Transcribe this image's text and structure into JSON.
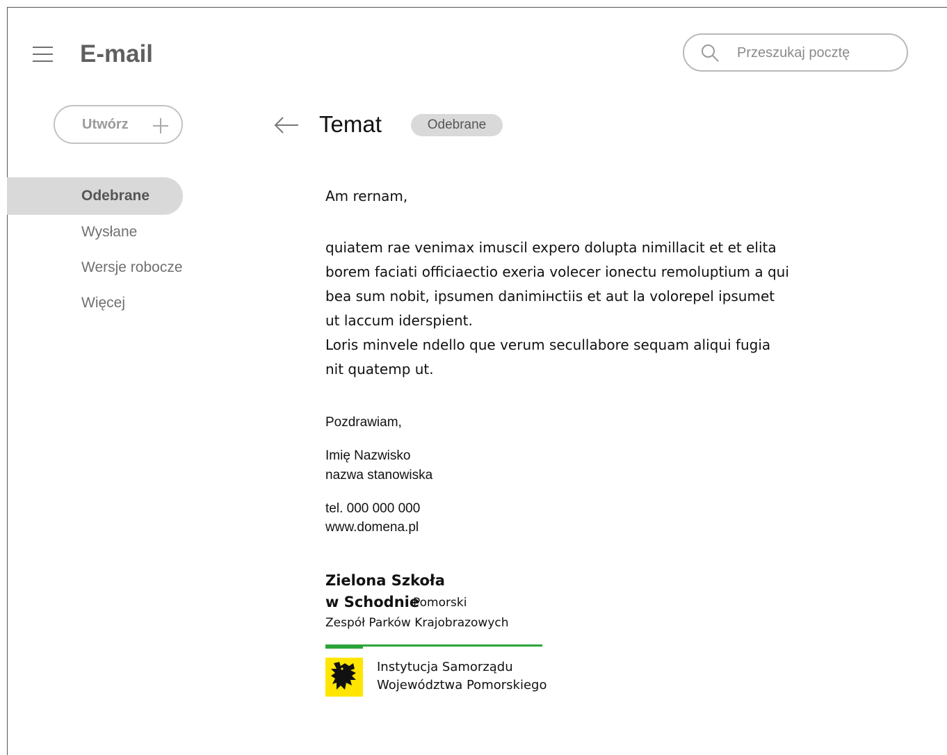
{
  "header": {
    "app_title": "E-mail",
    "search_placeholder": "Przeszukaj pocztę"
  },
  "sidebar": {
    "compose_label": "Utwórz",
    "items": [
      {
        "label": "Odebrane",
        "active": true
      },
      {
        "label": "Wysłane",
        "active": false
      },
      {
        "label": "Wersje robocze",
        "active": false
      },
      {
        "label": "Więcej",
        "active": false
      }
    ]
  },
  "message": {
    "subject": "Temat",
    "folder": "Odebrane",
    "greeting": "Am rernam,",
    "body_lines": [
      "quiatem rae venimax imuscil expero dolupta nimillacit et et elita",
      "borem faciati officiaectio exeria volecer ionectu remoluptium a qui",
      "bea sum nobit, ipsumen danimінctiis et aut la volorepel ipsumet",
      "ut laccum iderspient.",
      "Loris minvele ndello que verum secullabore sequam aliqui fugia",
      "nit quatemp ut."
    ],
    "closing": "Pozdrawiam,",
    "name": "Imię Nazwisko",
    "position": "nazwa stanowiska",
    "phone": "tel. 000 000 000",
    "website": "www.domena.pl"
  },
  "footer_logo": {
    "org_line1": "Zielona Szkoła",
    "org_line2_bold": "w Schodnie",
    "org_line2_light": "Pomorski",
    "org_line3": "Zespół Parków Krajobrazowych",
    "institution_line1": "Instytucja Samorządu",
    "institution_line2": "Województwa Pomorskiego",
    "accent_color": "#2aa43a",
    "emblem_color": "#ffe500"
  }
}
